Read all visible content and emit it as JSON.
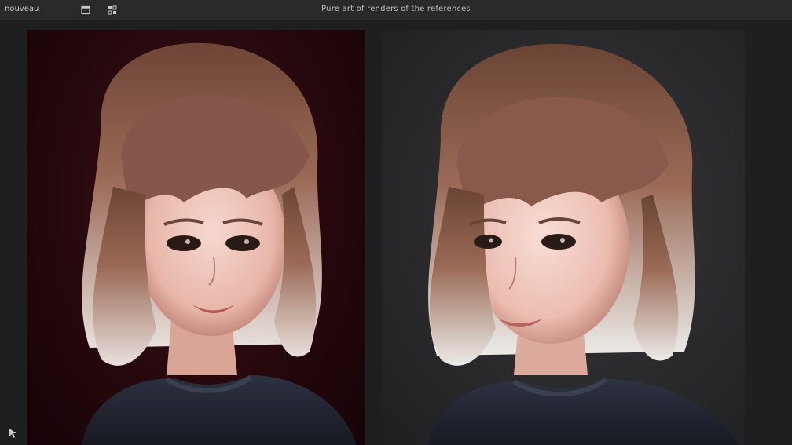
{
  "app": {
    "label": "nouveau"
  },
  "window": {
    "title": "Pure art of renders of the references"
  },
  "toolbar": {
    "icons": [
      {
        "name": "window-icon"
      },
      {
        "name": "grid-icon"
      }
    ]
  },
  "panels": {
    "left": {
      "image": "portrait-red-background",
      "background": "#26080d"
    },
    "right": {
      "image": "portrait-gray-background",
      "background": "#2a2a2d"
    }
  },
  "corner": {
    "icon": "cursor-move-icon"
  },
  "colors": {
    "topbar": "#2a2a2d",
    "workspace": "#1f1f22",
    "hair": "#8a5a48",
    "sweater": "#2a2d38",
    "skin": "#f0c9be"
  }
}
